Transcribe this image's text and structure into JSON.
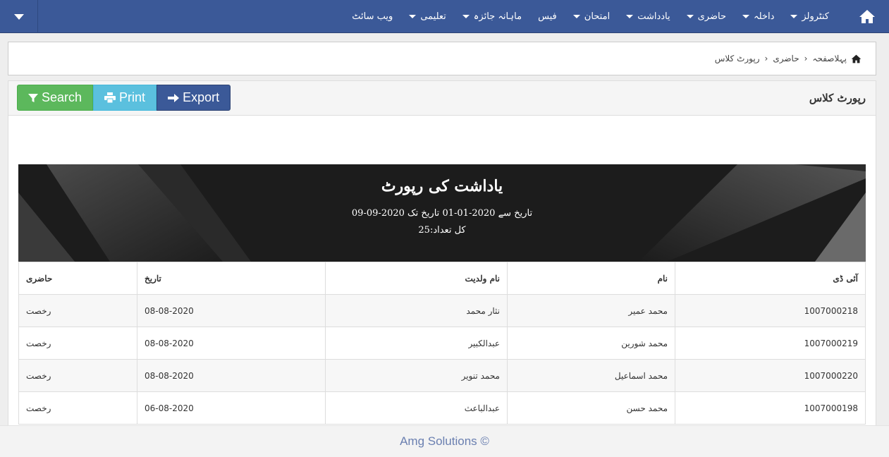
{
  "navbar": {
    "items": [
      {
        "label": "کنٹرولز",
        "dropdown": true
      },
      {
        "label": "داخلہ",
        "dropdown": true
      },
      {
        "label": "حاضری",
        "dropdown": true
      },
      {
        "label": "یادداشت",
        "dropdown": true
      },
      {
        "label": "امتحان",
        "dropdown": true
      },
      {
        "label": "فیس",
        "dropdown": false
      },
      {
        "label": "ماہانہ جائزہ",
        "dropdown": true
      },
      {
        "label": "تعلیمی",
        "dropdown": true
      },
      {
        "label": "ویب سائٹ",
        "dropdown": false
      }
    ]
  },
  "breadcrumb": {
    "home": "پہلاصفحہ",
    "section": "حاضری",
    "current": "رپورٹ کلاس"
  },
  "panel": {
    "title": "رپورٹ کلاس",
    "buttons": {
      "search": "Search",
      "print": "Print",
      "export": "Export"
    }
  },
  "report": {
    "title": "یاداشت کی رپورٹ",
    "range_label": "تاریخ سے",
    "from_date": "2020-01-01",
    "to_label": "تاریخ تک",
    "to_date": "2020-09-09",
    "range_text": "تاریخ سے 2020-01-01 تاریخ تک 2020-09-09",
    "count_text": "کل تعداد:25"
  },
  "table": {
    "headers": {
      "id": "آئی ڈی",
      "name": "نام",
      "father_name": "نام ولدیت",
      "date": "تاریخ",
      "status": "حاضری"
    },
    "rows": [
      {
        "id": "1007000218",
        "name": "محمد عمیر",
        "father_name": "نثار محمد",
        "date": "08-08-2020",
        "status": "رخصت"
      },
      {
        "id": "1007000219",
        "name": "محمد شورین",
        "father_name": "عبدالکبیر",
        "date": "08-08-2020",
        "status": "رخصت"
      },
      {
        "id": "1007000220",
        "name": "محمد اسماعیل",
        "father_name": "محمد تنویر",
        "date": "08-08-2020",
        "status": "رخصت"
      },
      {
        "id": "1007000198",
        "name": "محمد حسن",
        "father_name": "عبدالباعث",
        "date": "06-08-2020",
        "status": "رخصت"
      }
    ]
  },
  "footer": {
    "text": "Amg Solutions ©"
  },
  "colors": {
    "navbar": "#3b5998",
    "search": "#5cb85c",
    "print": "#5bc0de",
    "export": "#3b5998",
    "banner": "#1c1c1c"
  }
}
